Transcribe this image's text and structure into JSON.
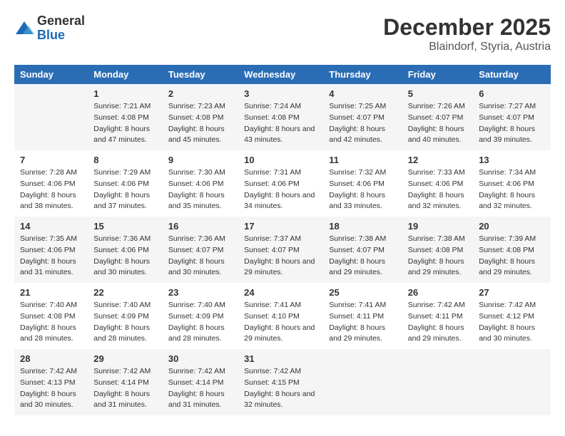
{
  "header": {
    "logo": {
      "general": "General",
      "blue": "Blue"
    },
    "title": "December 2025",
    "subtitle": "Blaindorf, Styria, Austria"
  },
  "weekdays": [
    "Sunday",
    "Monday",
    "Tuesday",
    "Wednesday",
    "Thursday",
    "Friday",
    "Saturday"
  ],
  "weeks": [
    [
      {
        "day": "",
        "sunrise": "",
        "sunset": "",
        "daylight": ""
      },
      {
        "day": "1",
        "sunrise": "Sunrise: 7:21 AM",
        "sunset": "Sunset: 4:08 PM",
        "daylight": "Daylight: 8 hours and 47 minutes."
      },
      {
        "day": "2",
        "sunrise": "Sunrise: 7:23 AM",
        "sunset": "Sunset: 4:08 PM",
        "daylight": "Daylight: 8 hours and 45 minutes."
      },
      {
        "day": "3",
        "sunrise": "Sunrise: 7:24 AM",
        "sunset": "Sunset: 4:08 PM",
        "daylight": "Daylight: 8 hours and 43 minutes."
      },
      {
        "day": "4",
        "sunrise": "Sunrise: 7:25 AM",
        "sunset": "Sunset: 4:07 PM",
        "daylight": "Daylight: 8 hours and 42 minutes."
      },
      {
        "day": "5",
        "sunrise": "Sunrise: 7:26 AM",
        "sunset": "Sunset: 4:07 PM",
        "daylight": "Daylight: 8 hours and 40 minutes."
      },
      {
        "day": "6",
        "sunrise": "Sunrise: 7:27 AM",
        "sunset": "Sunset: 4:07 PM",
        "daylight": "Daylight: 8 hours and 39 minutes."
      }
    ],
    [
      {
        "day": "7",
        "sunrise": "Sunrise: 7:28 AM",
        "sunset": "Sunset: 4:06 PM",
        "daylight": "Daylight: 8 hours and 38 minutes."
      },
      {
        "day": "8",
        "sunrise": "Sunrise: 7:29 AM",
        "sunset": "Sunset: 4:06 PM",
        "daylight": "Daylight: 8 hours and 37 minutes."
      },
      {
        "day": "9",
        "sunrise": "Sunrise: 7:30 AM",
        "sunset": "Sunset: 4:06 PM",
        "daylight": "Daylight: 8 hours and 35 minutes."
      },
      {
        "day": "10",
        "sunrise": "Sunrise: 7:31 AM",
        "sunset": "Sunset: 4:06 PM",
        "daylight": "Daylight: 8 hours and 34 minutes."
      },
      {
        "day": "11",
        "sunrise": "Sunrise: 7:32 AM",
        "sunset": "Sunset: 4:06 PM",
        "daylight": "Daylight: 8 hours and 33 minutes."
      },
      {
        "day": "12",
        "sunrise": "Sunrise: 7:33 AM",
        "sunset": "Sunset: 4:06 PM",
        "daylight": "Daylight: 8 hours and 32 minutes."
      },
      {
        "day": "13",
        "sunrise": "Sunrise: 7:34 AM",
        "sunset": "Sunset: 4:06 PM",
        "daylight": "Daylight: 8 hours and 32 minutes."
      }
    ],
    [
      {
        "day": "14",
        "sunrise": "Sunrise: 7:35 AM",
        "sunset": "Sunset: 4:06 PM",
        "daylight": "Daylight: 8 hours and 31 minutes."
      },
      {
        "day": "15",
        "sunrise": "Sunrise: 7:36 AM",
        "sunset": "Sunset: 4:06 PM",
        "daylight": "Daylight: 8 hours and 30 minutes."
      },
      {
        "day": "16",
        "sunrise": "Sunrise: 7:36 AM",
        "sunset": "Sunset: 4:07 PM",
        "daylight": "Daylight: 8 hours and 30 minutes."
      },
      {
        "day": "17",
        "sunrise": "Sunrise: 7:37 AM",
        "sunset": "Sunset: 4:07 PM",
        "daylight": "Daylight: 8 hours and 29 minutes."
      },
      {
        "day": "18",
        "sunrise": "Sunrise: 7:38 AM",
        "sunset": "Sunset: 4:07 PM",
        "daylight": "Daylight: 8 hours and 29 minutes."
      },
      {
        "day": "19",
        "sunrise": "Sunrise: 7:38 AM",
        "sunset": "Sunset: 4:08 PM",
        "daylight": "Daylight: 8 hours and 29 minutes."
      },
      {
        "day": "20",
        "sunrise": "Sunrise: 7:39 AM",
        "sunset": "Sunset: 4:08 PM",
        "daylight": "Daylight: 8 hours and 29 minutes."
      }
    ],
    [
      {
        "day": "21",
        "sunrise": "Sunrise: 7:40 AM",
        "sunset": "Sunset: 4:08 PM",
        "daylight": "Daylight: 8 hours and 28 minutes."
      },
      {
        "day": "22",
        "sunrise": "Sunrise: 7:40 AM",
        "sunset": "Sunset: 4:09 PM",
        "daylight": "Daylight: 8 hours and 28 minutes."
      },
      {
        "day": "23",
        "sunrise": "Sunrise: 7:40 AM",
        "sunset": "Sunset: 4:09 PM",
        "daylight": "Daylight: 8 hours and 28 minutes."
      },
      {
        "day": "24",
        "sunrise": "Sunrise: 7:41 AM",
        "sunset": "Sunset: 4:10 PM",
        "daylight": "Daylight: 8 hours and 29 minutes."
      },
      {
        "day": "25",
        "sunrise": "Sunrise: 7:41 AM",
        "sunset": "Sunset: 4:11 PM",
        "daylight": "Daylight: 8 hours and 29 minutes."
      },
      {
        "day": "26",
        "sunrise": "Sunrise: 7:42 AM",
        "sunset": "Sunset: 4:11 PM",
        "daylight": "Daylight: 8 hours and 29 minutes."
      },
      {
        "day": "27",
        "sunrise": "Sunrise: 7:42 AM",
        "sunset": "Sunset: 4:12 PM",
        "daylight": "Daylight: 8 hours and 30 minutes."
      }
    ],
    [
      {
        "day": "28",
        "sunrise": "Sunrise: 7:42 AM",
        "sunset": "Sunset: 4:13 PM",
        "daylight": "Daylight: 8 hours and 30 minutes."
      },
      {
        "day": "29",
        "sunrise": "Sunrise: 7:42 AM",
        "sunset": "Sunset: 4:14 PM",
        "daylight": "Daylight: 8 hours and 31 minutes."
      },
      {
        "day": "30",
        "sunrise": "Sunrise: 7:42 AM",
        "sunset": "Sunset: 4:14 PM",
        "daylight": "Daylight: 8 hours and 31 minutes."
      },
      {
        "day": "31",
        "sunrise": "Sunrise: 7:42 AM",
        "sunset": "Sunset: 4:15 PM",
        "daylight": "Daylight: 8 hours and 32 minutes."
      },
      {
        "day": "",
        "sunrise": "",
        "sunset": "",
        "daylight": ""
      },
      {
        "day": "",
        "sunrise": "",
        "sunset": "",
        "daylight": ""
      },
      {
        "day": "",
        "sunrise": "",
        "sunset": "",
        "daylight": ""
      }
    ]
  ]
}
